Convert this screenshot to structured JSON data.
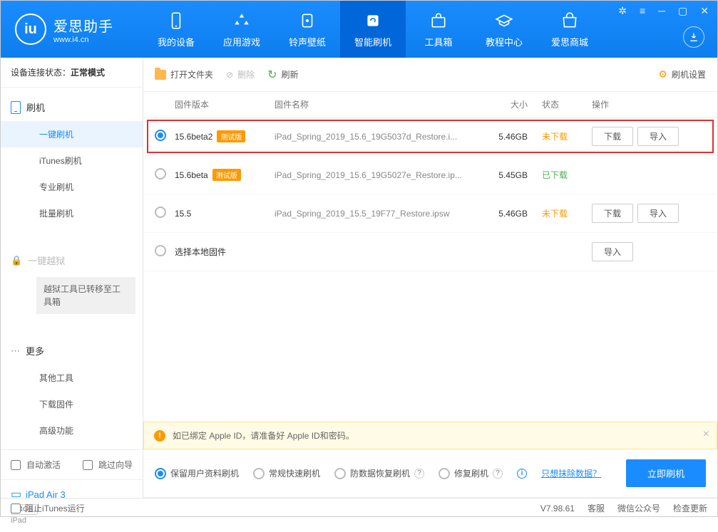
{
  "logo": {
    "title": "爱思助手",
    "sub": "www.i4.cn",
    "mark": "iu"
  },
  "nav": [
    {
      "label": "我的设备"
    },
    {
      "label": "应用游戏"
    },
    {
      "label": "铃声壁纸"
    },
    {
      "label": "智能刷机"
    },
    {
      "label": "工具箱"
    },
    {
      "label": "教程中心"
    },
    {
      "label": "爱思商城"
    }
  ],
  "sidebar": {
    "conn_label": "设备连接状态：",
    "conn_value": "正常模式",
    "flash_heading": "刷机",
    "items_flash": [
      {
        "label": "一键刷机"
      },
      {
        "label": "iTunes刷机"
      },
      {
        "label": "专业刷机"
      },
      {
        "label": "批量刷机"
      }
    ],
    "jailbreak_heading": "一键越狱",
    "jailbreak_notice": "越狱工具已转移至工具箱",
    "more_heading": "更多",
    "items_more": [
      {
        "label": "其他工具"
      },
      {
        "label": "下载固件"
      },
      {
        "label": "高级功能"
      }
    ],
    "auto_activate": "自动激活",
    "skip_guide": "跳过向导",
    "device_name": "iPad Air 3",
    "device_cap": "64GB",
    "device_type": "iPad"
  },
  "toolbar": {
    "open_folder": "打开文件夹",
    "delete": "删除",
    "refresh": "刷新",
    "settings": "刷机设置"
  },
  "table": {
    "headers": {
      "version": "固件版本",
      "name": "固件名称",
      "size": "大小",
      "status": "状态",
      "ops": "操作"
    },
    "rows": [
      {
        "version": "15.6beta2",
        "beta": "测试版",
        "name": "iPad_Spring_2019_15.6_19G5037d_Restore.i...",
        "size": "5.46GB",
        "status": "未下载",
        "status_class": "status-orange",
        "checked": true,
        "highlighted": true,
        "download": "下载",
        "import": "导入"
      },
      {
        "version": "15.6beta",
        "beta": "测试版",
        "name": "iPad_Spring_2019_15.6_19G5027e_Restore.ip...",
        "size": "5.45GB",
        "status": "已下载",
        "status_class": "status-green"
      },
      {
        "version": "15.5",
        "name": "iPad_Spring_2019_15.5_19F77_Restore.ipsw",
        "size": "5.46GB",
        "status": "未下载",
        "status_class": "status-orange",
        "download": "下载",
        "import": "导入"
      },
      {
        "version": "选择本地固件",
        "local": true,
        "import": "导入"
      }
    ]
  },
  "notice": "如已绑定 Apple ID，请准备好 Apple ID和密码。",
  "actions": {
    "opts": [
      {
        "label": "保留用户资料刷机",
        "checked": true
      },
      {
        "label": "常规快速刷机"
      },
      {
        "label": "防数据恢复刷机",
        "help": true
      },
      {
        "label": "修复刷机",
        "help": true
      }
    ],
    "erase_link": "只想抹除数据？",
    "primary": "立即刷机"
  },
  "footer": {
    "block_itunes": "阻止iTunes运行",
    "version": "V7.98.61",
    "support": "客服",
    "wechat": "微信公众号",
    "check_update": "检查更新"
  }
}
